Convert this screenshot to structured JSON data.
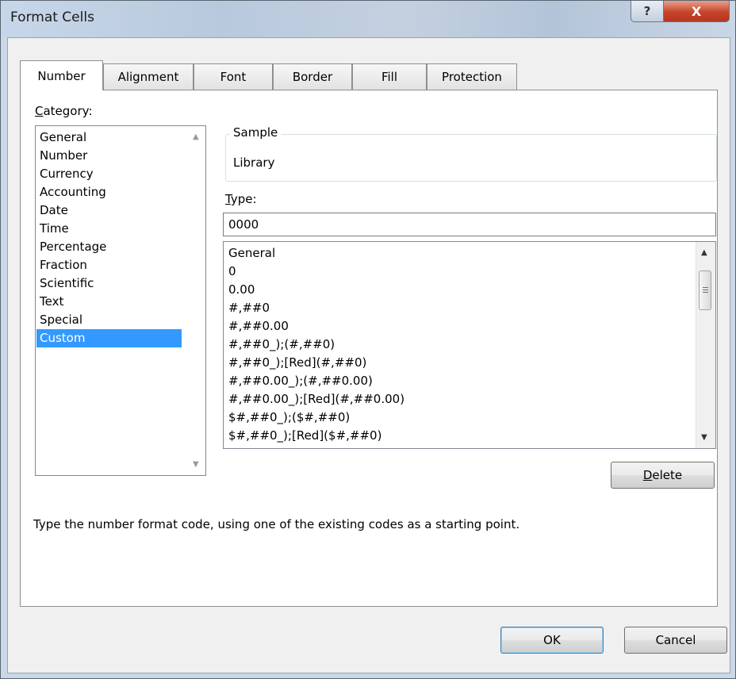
{
  "window": {
    "title": "Format Cells",
    "help_glyph": "?",
    "close_glyph": "X"
  },
  "tabs": [
    {
      "label": "Number",
      "active": true
    },
    {
      "label": "Alignment",
      "active": false
    },
    {
      "label": "Font",
      "active": false
    },
    {
      "label": "Border",
      "active": false
    },
    {
      "label": "Fill",
      "active": false
    },
    {
      "label": "Protection",
      "active": false
    }
  ],
  "category": {
    "label_hotkey": "C",
    "label_rest": "ategory:",
    "items": [
      "General",
      "Number",
      "Currency",
      "Accounting",
      "Date",
      "Time",
      "Percentage",
      "Fraction",
      "Scientific",
      "Text",
      "Special",
      "Custom"
    ],
    "selected": "Custom"
  },
  "sample": {
    "legend": "Sample",
    "value": "Library"
  },
  "type": {
    "label_hotkey": "T",
    "label_rest": "ype:",
    "value": "0000",
    "formats": [
      "General",
      "0",
      "0.00",
      "#,##0",
      "#,##0.00",
      "#,##0_);(#,##0)",
      "#,##0_);[Red](#,##0)",
      "#,##0.00_);(#,##0.00)",
      "#,##0.00_);[Red](#,##0.00)",
      "$#,##0_);($#,##0)",
      "$#,##0_);[Red]($#,##0)"
    ]
  },
  "buttons": {
    "delete_hotkey": "D",
    "delete_rest": "elete",
    "ok": "OK",
    "cancel": "Cancel"
  },
  "hint": "Type the number format code, using one of the existing codes as a starting point.",
  "colors": {
    "selection": "#3399ff",
    "close_button": "#c7442a"
  }
}
